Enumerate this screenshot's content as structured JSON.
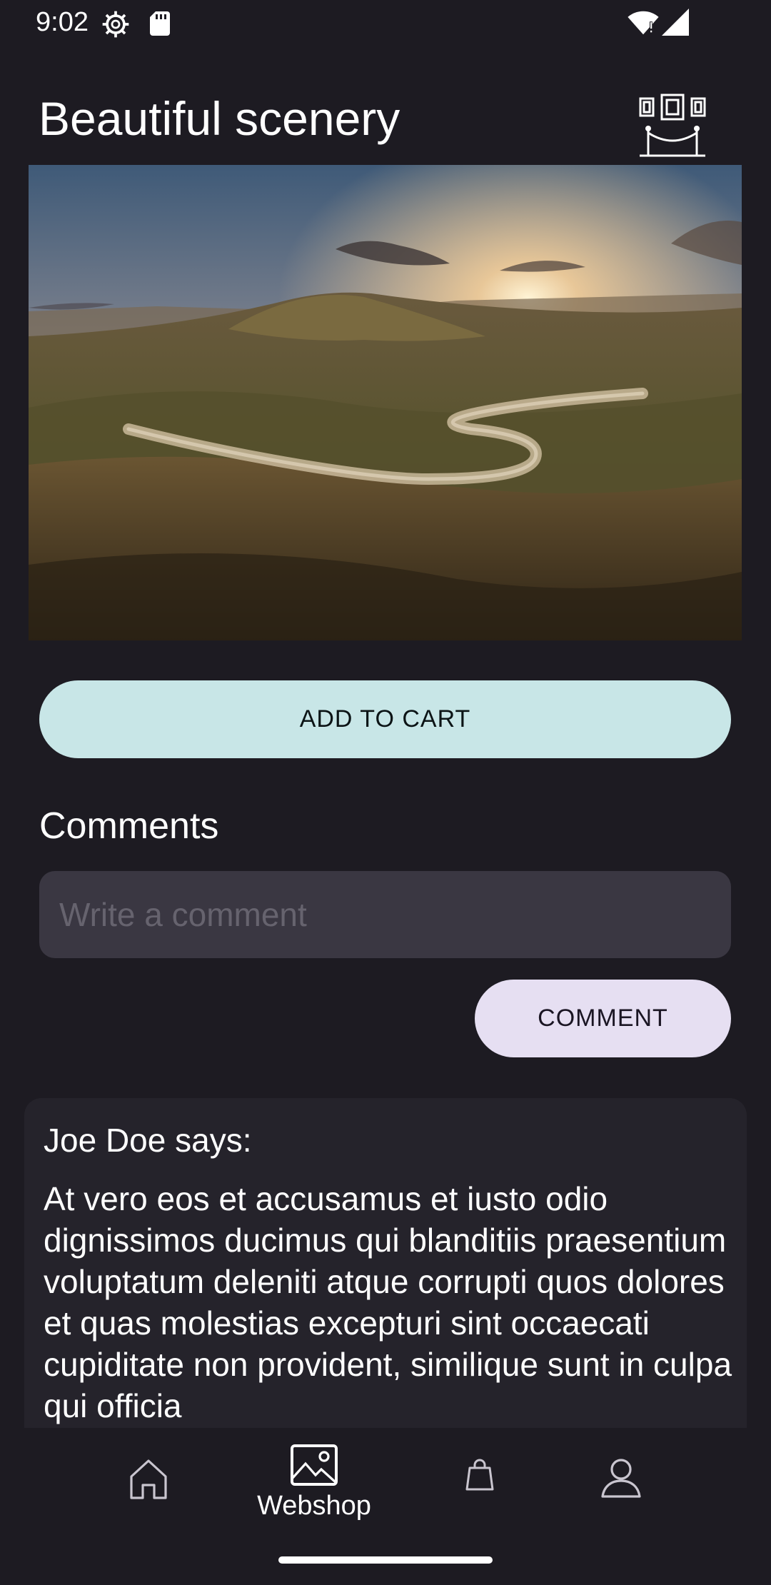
{
  "status_bar": {
    "time": "9:02",
    "icons": [
      "gear-icon",
      "sd-card-icon",
      "wifi-alert-icon",
      "cell-signal-icon"
    ]
  },
  "header": {
    "title": "Beautiful scenery",
    "action_icon": "gallery-exhibit-icon"
  },
  "hero": {
    "image": "mountain-valley-sunset-winding-road"
  },
  "actions": {
    "add_to_cart_label": "ADD TO CART"
  },
  "comments": {
    "heading": "Comments",
    "input_placeholder": "Write a comment",
    "input_value": "",
    "submit_label": "COMMENT",
    "items": [
      {
        "author_line": "Joe Doe says:",
        "text": "At vero eos et accusamus et iusto odio dignissimos ducimus qui blanditiis praesentium voluptatum deleniti atque corrupti quos dolores et quas molestias excepturi sint occaecati cupiditate non provident, similique sunt in culpa qui officia"
      }
    ]
  },
  "bottom_nav": {
    "items": [
      {
        "icon": "home-icon",
        "label": "",
        "selected": false
      },
      {
        "icon": "image-icon",
        "label": "Webshop",
        "selected": true
      },
      {
        "icon": "shopping-bag-icon",
        "label": "",
        "selected": false
      },
      {
        "icon": "person-icon",
        "label": "",
        "selected": false
      }
    ]
  },
  "colors": {
    "background": "#1d1b22",
    "add_to_cart_bg": "#c8e6e7",
    "comment_button_bg": "#e6dff2",
    "input_bg": "#3a3742",
    "card_bg": "#25232b"
  }
}
